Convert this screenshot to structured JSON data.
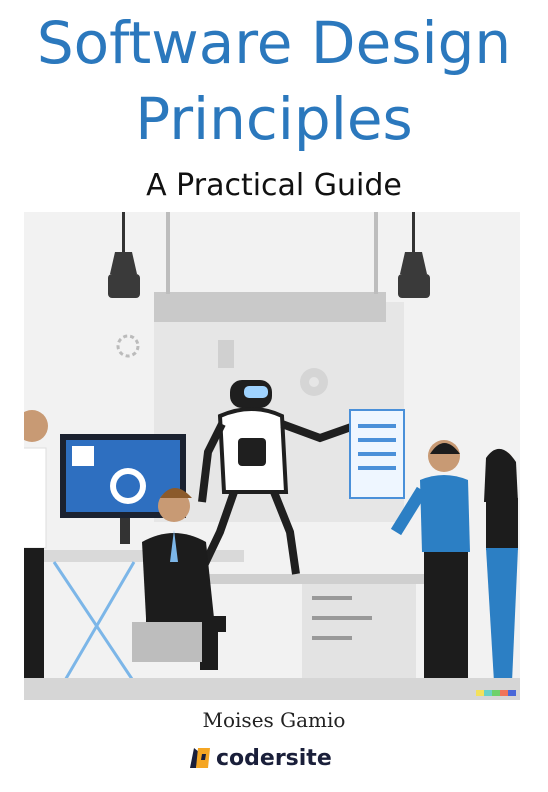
{
  "cover": {
    "title_line1": "Software Design",
    "title_line2": "Principles",
    "subtitle": "A Practical Guide",
    "author": "Moises Gamio",
    "publisher": "codersite"
  },
  "colors": {
    "title": "#2b78bd",
    "accent_orange": "#f5a623",
    "logo_dark": "#1a1f3a"
  },
  "icons": [
    "gear-icon",
    "robot-icon",
    "monitor-icon",
    "lamp-icon",
    "document-icon"
  ]
}
